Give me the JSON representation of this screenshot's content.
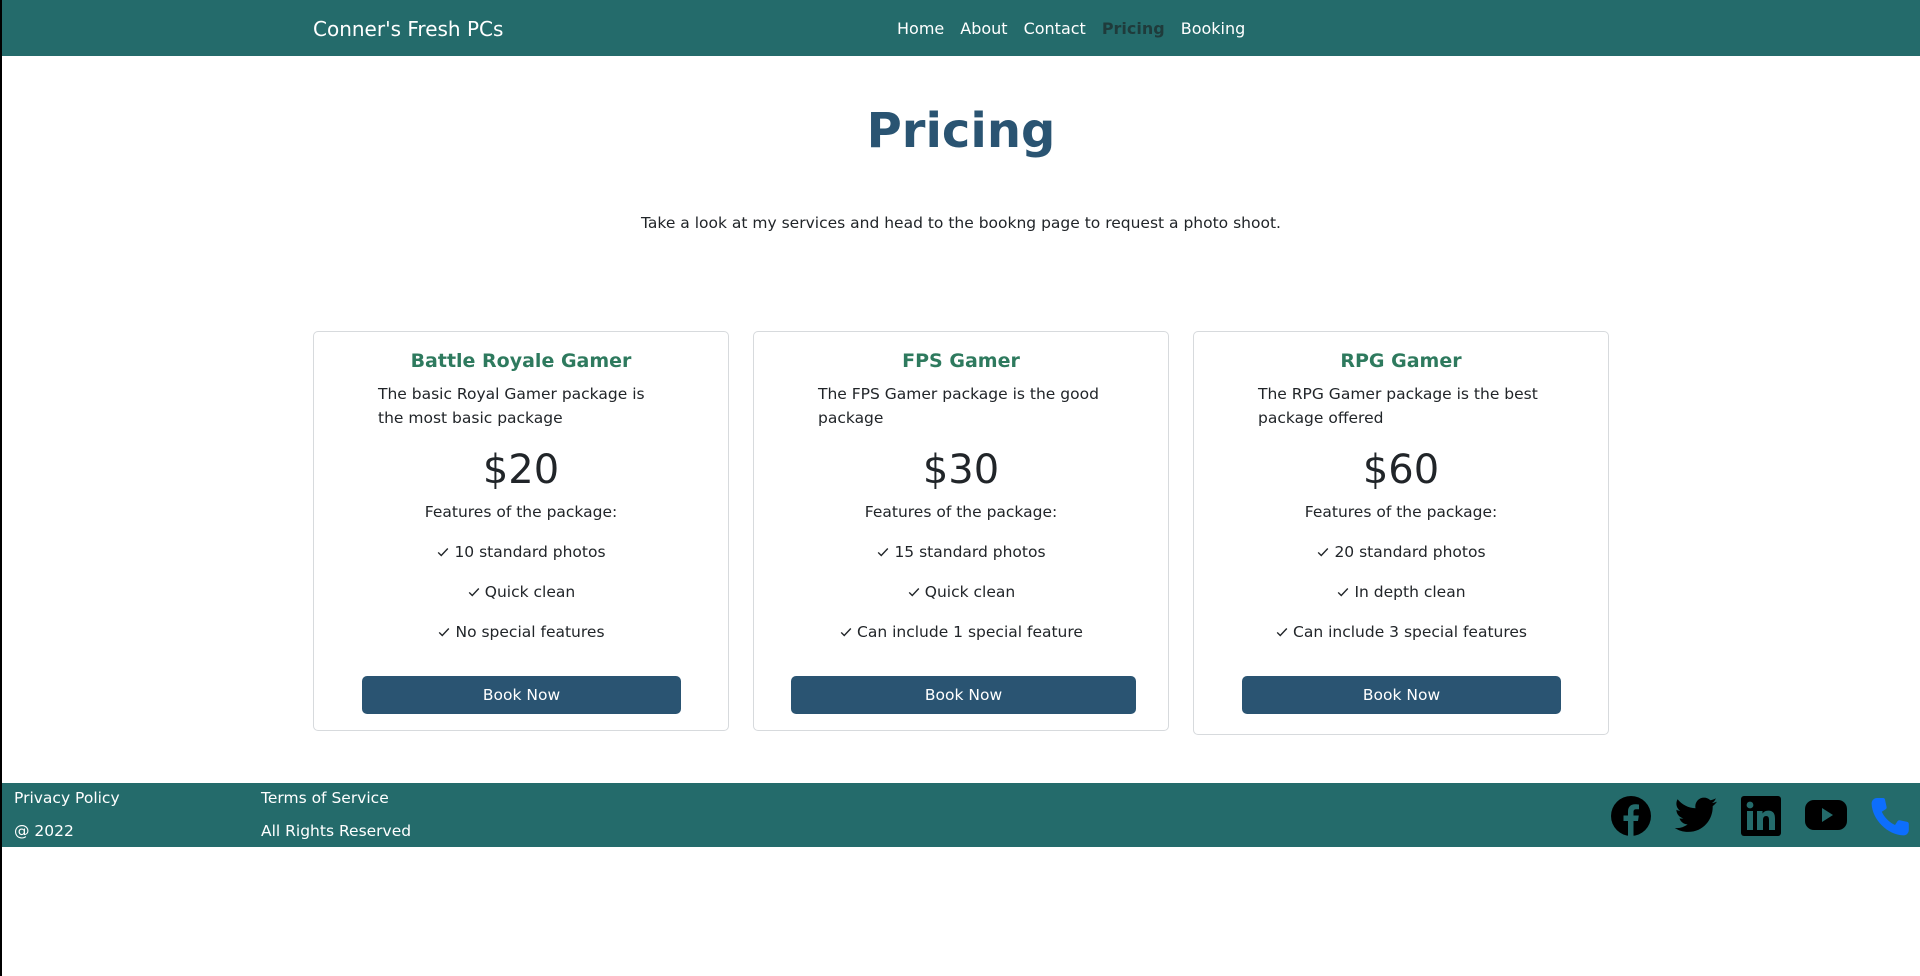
{
  "navbar": {
    "brand": "Conner's Fresh PCs",
    "links": [
      {
        "label": "Home",
        "active": false
      },
      {
        "label": "About",
        "active": false
      },
      {
        "label": "Contact",
        "active": false
      },
      {
        "label": "Pricing",
        "active": true
      },
      {
        "label": "Booking",
        "active": false
      }
    ]
  },
  "hero": {
    "title": "Pricing",
    "lead": "Take a look at my services and head to the bookng page to request a photo shoot."
  },
  "cards": [
    {
      "title": "Battle Royale Gamer",
      "description": "The basic Royal Gamer package is the most basic package",
      "price": "$20",
      "features_title": "Features of the package:",
      "features": [
        "10 standard photos",
        "Quick clean",
        "No special features"
      ],
      "button": "Book Now"
    },
    {
      "title": "FPS Gamer",
      "description": "The FPS Gamer package is the good package",
      "price": "$30",
      "features_title": "Features of the package:",
      "features": [
        "15 standard photos",
        "Quick clean",
        "Can include 1 special feature"
      ],
      "button": "Book Now"
    },
    {
      "title": "RPG Gamer",
      "description": "The RPG Gamer package is the best package offered",
      "price": "$60",
      "features_title": "Features of the package:",
      "features": [
        "20 standard photos",
        "In depth clean",
        "Can include 3 special features"
      ],
      "button": "Book Now"
    }
  ],
  "footer": {
    "privacy": "Privacy Policy",
    "copyright": "@ 2022",
    "terms": "Terms of Service",
    "rights": "All Rights Reserved",
    "social_icons": [
      "facebook-icon",
      "twitter-icon",
      "linkedin-icon",
      "youtube-icon",
      "phone-icon"
    ]
  },
  "colors": {
    "navbar": "#246b6b",
    "heading": "#2a5472",
    "card_title": "#2e7a5e",
    "button": "#2a5472",
    "phone_icon": "#0d6efd"
  }
}
